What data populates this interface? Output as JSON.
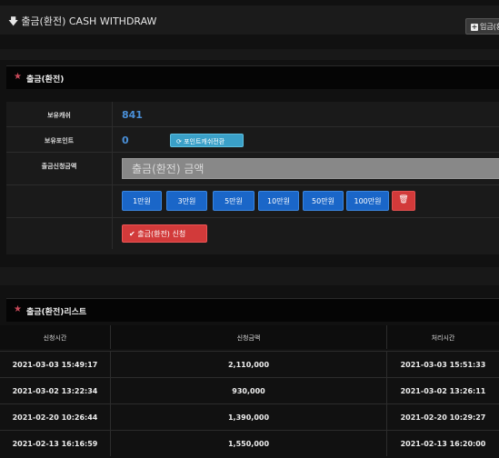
{
  "header": {
    "title": "출금(환전) CASH WITHDRAW",
    "deposit_button": "입금(환전)"
  },
  "panel": {
    "title": "출금(환전)"
  },
  "form": {
    "cash_label": "보유캐쉬",
    "cash_value": "841",
    "points_label": "보유포인트",
    "points_value": "0",
    "convert_button": "포인트캐쉬전환",
    "amount_label": "출금신청금액",
    "amount_placeholder": "출금(환전) 금액",
    "amount_buttons": [
      "1만원",
      "3만원",
      "5만원",
      "10만원",
      "50만원",
      "100만원"
    ],
    "submit_button": "출금(환전) 신청"
  },
  "list": {
    "title": "출금(환전)리스트",
    "columns": [
      "신청시간",
      "신청금액",
      "처리시간"
    ],
    "rows": [
      {
        "requested": "2021-03-03 15:49:17",
        "amount": "2,110,000",
        "processed": "2021-03-03 15:51:33"
      },
      {
        "requested": "2021-03-02 13:22:34",
        "amount": "930,000",
        "processed": "2021-03-02 13:26:11"
      },
      {
        "requested": "2021-02-20 10:26:44",
        "amount": "1,390,000",
        "processed": "2021-02-20 10:29:27"
      },
      {
        "requested": "2021-02-13 16:16:59",
        "amount": "1,550,000",
        "processed": "2021-02-13 16:20:00"
      }
    ]
  }
}
